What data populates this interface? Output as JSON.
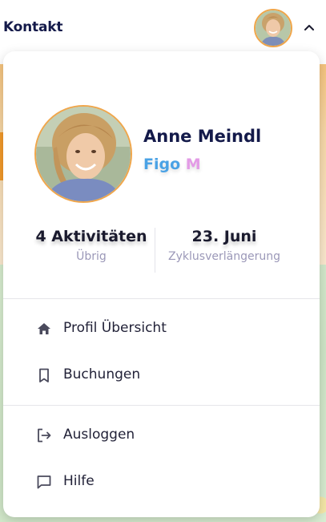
{
  "header": {
    "brand": "Kontakt"
  },
  "profile": {
    "name": "Anne Meindl",
    "plan_part1": "Figo",
    "plan_part2": "M"
  },
  "stats": [
    {
      "value": "4 Aktivitäten",
      "label": "Übrig"
    },
    {
      "value": "23. Juni",
      "label": "Zyklusverlängerung"
    }
  ],
  "menu": {
    "profile_overview": {
      "label": "Profil Übersicht",
      "icon": "home-icon"
    },
    "bookings": {
      "label": "Buchungen",
      "icon": "bookmark-icon"
    },
    "logout": {
      "label": "Ausloggen",
      "icon": "logout-icon"
    },
    "help": {
      "label": "Hilfe",
      "icon": "chat-icon"
    }
  },
  "colors": {
    "brand_text": "#141a4a",
    "avatar_ring": "#f0a64b",
    "plan_blue": "#4aa2e5",
    "plan_pink": "#e39be6",
    "muted_label": "#9b98b8"
  }
}
